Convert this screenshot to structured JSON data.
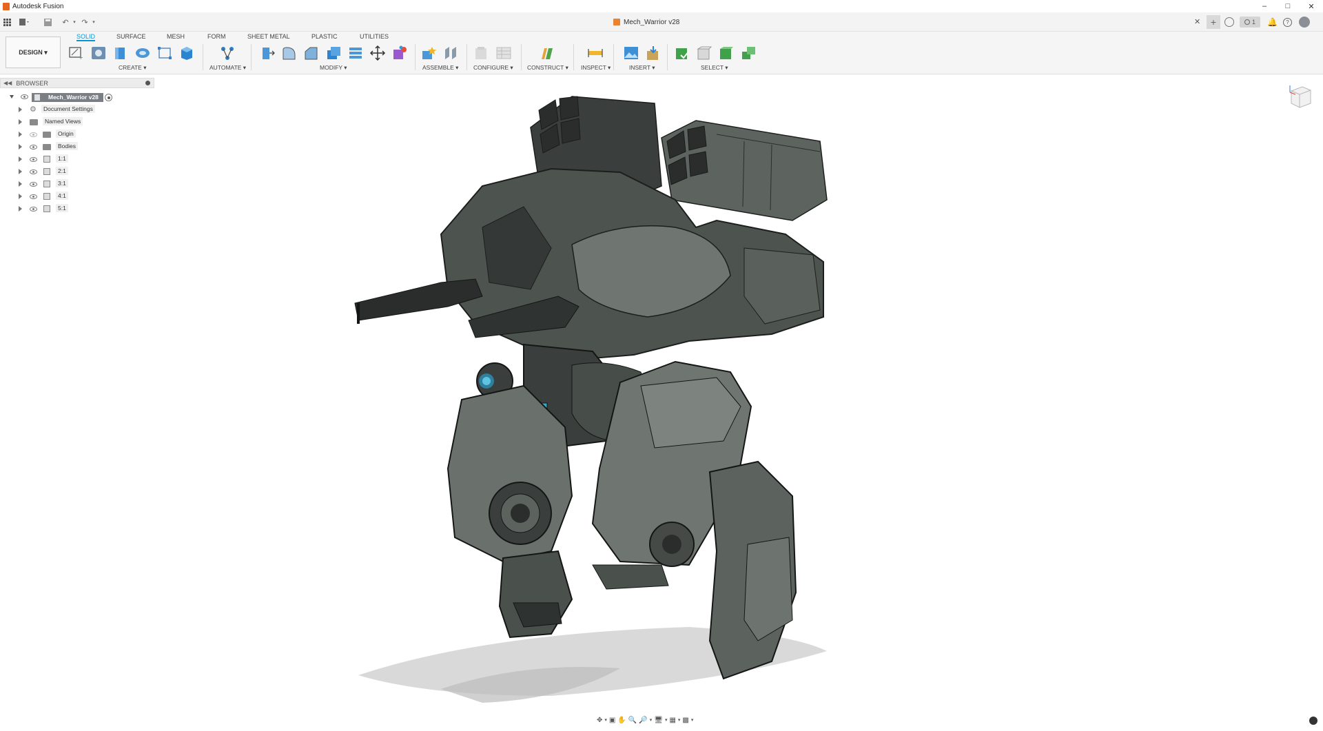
{
  "window": {
    "app_title": "Autodesk Fusion"
  },
  "document": {
    "tab_title": "Mech_Warrior v28"
  },
  "ribbon": {
    "workspace_label": "DESIGN ▾",
    "tabs": [
      {
        "label": "SOLID",
        "active": true
      },
      {
        "label": "SURFACE",
        "active": false
      },
      {
        "label": "MESH",
        "active": false
      },
      {
        "label": "FORM",
        "active": false
      },
      {
        "label": "SHEET METAL",
        "active": false
      },
      {
        "label": "PLASTIC",
        "active": false
      },
      {
        "label": "UTILITIES",
        "active": false
      }
    ],
    "groups": [
      {
        "label": "CREATE ▾"
      },
      {
        "label": "AUTOMATE ▾"
      },
      {
        "label": "MODIFY ▾"
      },
      {
        "label": "ASSEMBLE ▾"
      },
      {
        "label": "CONFIGURE ▾"
      },
      {
        "label": "CONSTRUCT ▾"
      },
      {
        "label": "INSPECT ▾"
      },
      {
        "label": "INSERT ▾"
      },
      {
        "label": "SELECT ▾"
      }
    ]
  },
  "browser": {
    "title": "BROWSER",
    "root": "Mech_Warrior v28",
    "items": [
      {
        "label": "Document Settings",
        "icon": "gear-icon"
      },
      {
        "label": "Named Views",
        "icon": "folder-icon"
      },
      {
        "label": "Origin",
        "icon": "folder-icon"
      },
      {
        "label": "Bodies",
        "icon": "folder-icon"
      },
      {
        "label": "1:1",
        "icon": "component-icon"
      },
      {
        "label": "2:1",
        "icon": "component-icon"
      },
      {
        "label": "3:1",
        "icon": "component-icon"
      },
      {
        "label": "4:1",
        "icon": "component-icon"
      },
      {
        "label": "5:1",
        "icon": "component-icon"
      }
    ]
  },
  "status": {
    "job_count": "1"
  },
  "colors": {
    "accent": "#0696d7",
    "app_logo": "#e7641e",
    "mech_body": "#5d6460",
    "mech_dark": "#2e3230",
    "glow": "#3aa6c4"
  }
}
